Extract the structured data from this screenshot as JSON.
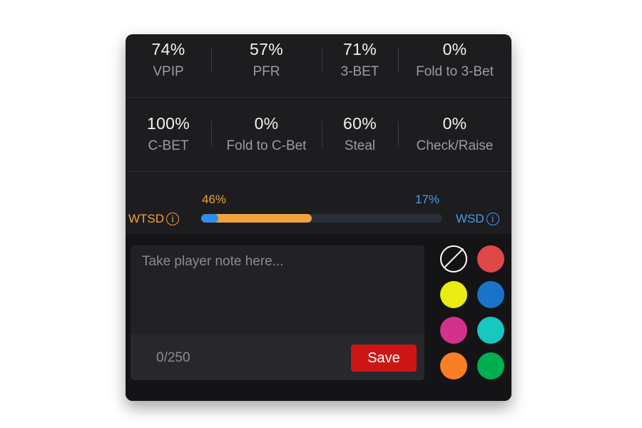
{
  "stats_row_1": [
    {
      "value": "74%",
      "label": "VPIP"
    },
    {
      "value": "57%",
      "label": "PFR"
    },
    {
      "value": "71%",
      "label": "3-BET"
    },
    {
      "value": "0%",
      "label": "Fold to 3-Bet"
    }
  ],
  "stats_row_2": [
    {
      "value": "100%",
      "label": "C-BET"
    },
    {
      "value": "0%",
      "label": "Fold to C-Bet"
    },
    {
      "value": "60%",
      "label": "Steal"
    },
    {
      "value": "0%",
      "label": "Check/Raise"
    }
  ],
  "showdown": {
    "wtsd_label": "WTSD",
    "wtsd_value": "46%",
    "wtsd_fraction": 0.46,
    "wsd_label": "WSD",
    "wsd_value": "17%",
    "wsd_fraction": 0.07,
    "info_icon": "i",
    "wtsd_color": "#f0a23f",
    "wsd_color": "#2f8df0"
  },
  "note": {
    "placeholder": "Take player note here...",
    "value": "",
    "char_count": "0/250",
    "save_label": "Save"
  },
  "colors": [
    {
      "name": "none",
      "hex": "transparent"
    },
    {
      "name": "red",
      "hex": "#e04848"
    },
    {
      "name": "yellow",
      "hex": "#e8ed14"
    },
    {
      "name": "blue",
      "hex": "#1a73c8"
    },
    {
      "name": "magenta",
      "hex": "#d4308c"
    },
    {
      "name": "teal",
      "hex": "#17c7c0"
    },
    {
      "name": "orange",
      "hex": "#fa7e23"
    },
    {
      "name": "green",
      "hex": "#00b050"
    }
  ]
}
